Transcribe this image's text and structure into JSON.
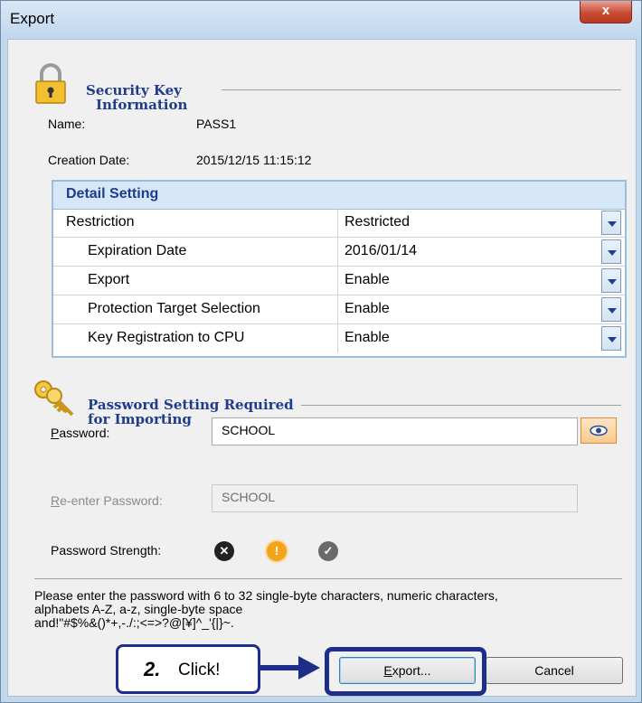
{
  "window": {
    "title": "Export",
    "close_glyph": "x"
  },
  "security_key": {
    "title_line1": "Security Key",
    "title_line2": "Information",
    "name_label": "Name:",
    "name_value": "PASS1",
    "creation_label": "Creation Date:",
    "creation_value": "2015/12/15 11:15:12"
  },
  "detail": {
    "header": "Detail Setting",
    "rows": [
      {
        "label": "Restriction",
        "value": "Restricted"
      },
      {
        "label": "Expiration Date",
        "value": "2016/01/14"
      },
      {
        "label": "Export",
        "value": "Enable"
      },
      {
        "label": "Protection Target Selection",
        "value": "Enable"
      },
      {
        "label": "Key Registration to CPU",
        "value": "Enable"
      }
    ]
  },
  "password_section": {
    "title_line1": "Password Setting Required",
    "title_line2": "for Importing",
    "password_label_first": "P",
    "password_label_rest": "assword:",
    "password_value": "SCHOOL",
    "reenter_label_first": "R",
    "reenter_label_rest": "e-enter Password:",
    "reenter_value": "SCHOOL",
    "strength_label": "Password Strength:"
  },
  "hint": {
    "line1": "Please enter the password with 6 to 32 single-byte characters, numeric characters,",
    "line2": "alphabets A-Z, a-z, single-byte space",
    "line3": "and!\"#$%&()*+,-./:;<=>?@[¥]^_'{|}~."
  },
  "buttons": {
    "export_first": "E",
    "export_rest": "xport...",
    "cancel": "Cancel"
  },
  "annotation": {
    "step": "2.",
    "text": "Click!"
  },
  "colors": {
    "section_title": "#1f3b8e",
    "annotation": "#1e2d8a",
    "grid_header_bg": "#d6e7f7"
  }
}
